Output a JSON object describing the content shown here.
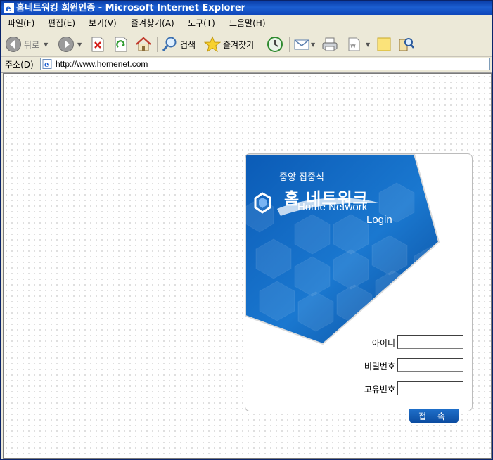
{
  "window": {
    "title": "홈네트워킹 회원인증 - Microsoft Internet Explorer"
  },
  "menu": {
    "items": [
      {
        "label": "파일(F)"
      },
      {
        "label": "편집(E)"
      },
      {
        "label": "보기(V)"
      },
      {
        "label": "즐겨찾기(A)"
      },
      {
        "label": "도구(T)"
      },
      {
        "label": "도움말(H)"
      }
    ]
  },
  "toolbar": {
    "back_label": "뒤로",
    "search_label": "검색",
    "favorites_label": "즐겨찾기"
  },
  "address": {
    "label": "주소(D)",
    "url": "http://www.homenet.com"
  },
  "login": {
    "brand_top": "중앙 집중식",
    "brand_main": "홈 네트워크",
    "brand_en": "Home Network",
    "brand_login": "Login",
    "fields": [
      {
        "label": "아이디",
        "value": ""
      },
      {
        "label": "비밀번호",
        "value": ""
      },
      {
        "label": "고유번호",
        "value": ""
      }
    ],
    "submit_label": "접 속"
  },
  "colors": {
    "title_bar": "#0a3ea8",
    "banner_blue": "#0d5fb8",
    "button_blue": "#0b4a9e"
  },
  "icons": [
    "ie-icon",
    "back-icon",
    "forward-icon",
    "stop-icon",
    "refresh-icon",
    "home-icon",
    "search-icon",
    "favorites-icon",
    "history-icon",
    "mail-icon",
    "print-icon",
    "edit-icon",
    "notes-icon",
    "research-icon",
    "page-icon"
  ]
}
